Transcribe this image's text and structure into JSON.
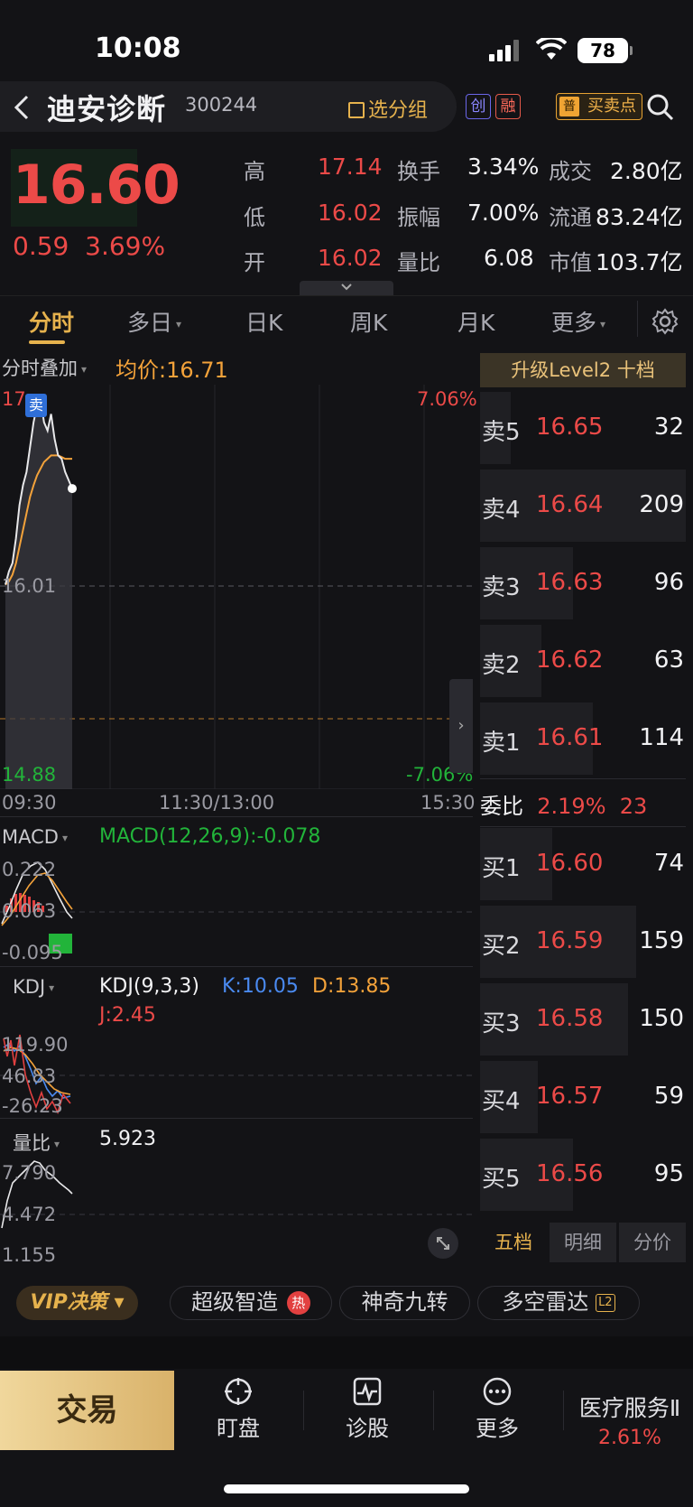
{
  "status_bar": {
    "time": "10:08",
    "battery": "78"
  },
  "header": {
    "back_icon": "chevron-left-icon",
    "stock_name": "迪安诊断",
    "stock_code": "300244",
    "add_group_label": "选分组",
    "tags": [
      "创",
      "融"
    ],
    "buy_sell_prefix": "普",
    "buy_sell_label": "买卖点",
    "search_icon": "search-icon"
  },
  "quote": {
    "price": "16.60",
    "change": "0.59",
    "change_pct": "3.69%",
    "rows": [
      [
        {
          "label": "高",
          "value": "17.14",
          "color": "#ec4a48"
        },
        {
          "label": "换手",
          "value": "3.34%"
        },
        {
          "label": "成交",
          "value": "2.80亿"
        }
      ],
      [
        {
          "label": "低",
          "value": "16.02",
          "color": "#ec4a48"
        },
        {
          "label": "振幅",
          "value": "7.00%"
        },
        {
          "label": "流通",
          "value": "83.24亿"
        }
      ],
      [
        {
          "label": "开",
          "value": "16.02",
          "color": "#ec4a48"
        },
        {
          "label": "量比",
          "value": "6.08"
        },
        {
          "label": "市值",
          "value": "103.7亿"
        }
      ]
    ]
  },
  "tabs": {
    "items": [
      "分时",
      "多日",
      "日K",
      "周K",
      "月K",
      "更多"
    ],
    "active": "分时"
  },
  "chart": {
    "overlay_label": "分时叠加",
    "avg_price_label": "均价:16.71",
    "price_top": "17",
    "sell_marker": "卖",
    "pct_top": "7.06%",
    "price_mid": "16.01",
    "price_bottom": "14.88",
    "pct_bottom": "-7.06%",
    "time_labels": [
      "09:30",
      "11:30/13:00",
      "15:30"
    ]
  },
  "chart_data": {
    "type": "line",
    "series": [
      {
        "values": [
          16.02,
          16.1,
          16.15,
          16.3,
          16.5,
          16.62,
          16.7,
          16.85,
          17.0,
          17.1,
          17.14,
          17.0,
          16.95,
          17.05,
          16.9,
          16.8,
          16.78,
          16.7,
          16.65,
          16.6
        ]
      },
      {
        "values": [
          16.02,
          16.04,
          16.08,
          16.15,
          16.25,
          16.35,
          16.45,
          16.55,
          16.62,
          16.68,
          16.72,
          16.76,
          16.78,
          16.8,
          16.8,
          16.8,
          16.79,
          16.78,
          16.78,
          16.78
        ]
      }
    ],
    "ylim": [
      14.88,
      17.14
    ]
  },
  "indicators": {
    "macd": {
      "name": "MACD",
      "value": "MACD(12,26,9):-0.078",
      "axis": [
        "0.222",
        "0.063",
        "-0.095"
      ]
    },
    "kdj": {
      "name": "KDJ",
      "params": "KDJ(9,3,3)",
      "k": "K:10.05",
      "d": "D:13.85",
      "j": "J:2.45",
      "axis": [
        "119.90",
        "46.83",
        "-26.23"
      ]
    },
    "volume_ratio": {
      "name": "量比",
      "value": "5.923",
      "axis": [
        "7.790",
        "4.472",
        "1.155"
      ]
    }
  },
  "order_book": {
    "level2_label": "升级Level2 十档",
    "asks": [
      {
        "label": "卖5",
        "price": "16.65",
        "vol": "32",
        "fill": 0.15
      },
      {
        "label": "卖4",
        "price": "16.64",
        "vol": "209",
        "fill": 1.0
      },
      {
        "label": "卖3",
        "price": "16.63",
        "vol": "96",
        "fill": 0.45
      },
      {
        "label": "卖2",
        "price": "16.62",
        "vol": "63",
        "fill": 0.3
      },
      {
        "label": "卖1",
        "price": "16.61",
        "vol": "114",
        "fill": 0.55
      }
    ],
    "ratio_label": "委比",
    "ratio_pct": "2.19%",
    "ratio_val": "23",
    "bids": [
      {
        "label": "买1",
        "price": "16.60",
        "vol": "74",
        "fill": 0.35
      },
      {
        "label": "买2",
        "price": "16.59",
        "vol": "159",
        "fill": 0.76
      },
      {
        "label": "买3",
        "price": "16.58",
        "vol": "150",
        "fill": 0.72
      },
      {
        "label": "买4",
        "price": "16.57",
        "vol": "59",
        "fill": 0.28
      },
      {
        "label": "买5",
        "price": "16.56",
        "vol": "95",
        "fill": 0.45
      }
    ],
    "tabs": [
      "五档",
      "明细",
      "分价"
    ]
  },
  "features": {
    "vip": "VIP决策",
    "items": [
      "超级智造",
      "神奇九转",
      "多空雷达"
    ],
    "hot": "热",
    "l2": "L2"
  },
  "bottom": {
    "trade": "交易",
    "nav": [
      {
        "label": "盯盘",
        "icon": "crosshair-icon"
      },
      {
        "label": "诊股",
        "icon": "pulse-icon"
      },
      {
        "label": "更多",
        "icon": "dots-icon"
      }
    ],
    "sector_name": "医疗服务Ⅱ",
    "sector_pct": "2.61%"
  }
}
